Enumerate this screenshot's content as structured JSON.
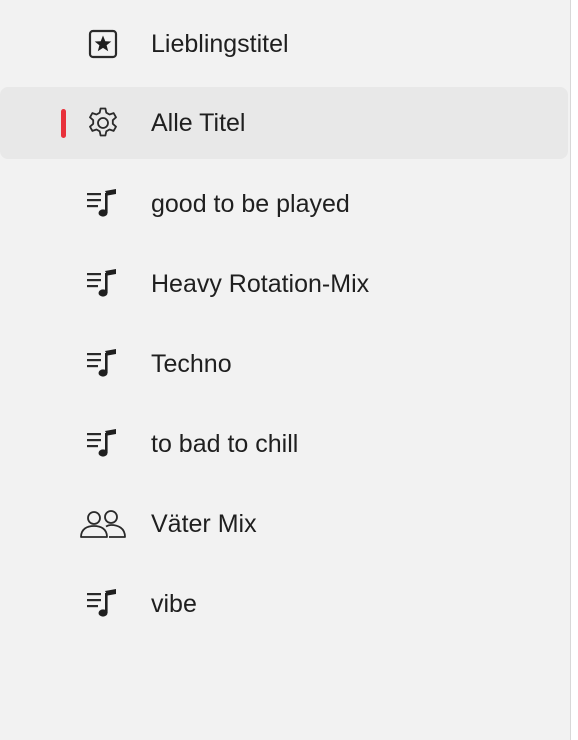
{
  "sidebar": {
    "selected_indicator_color": "#e8313b",
    "items": [
      {
        "label": "Lieblingstitel",
        "icon": "star-box-icon"
      },
      {
        "label": "Alle Titel",
        "icon": "gear-icon",
        "selected": true
      },
      {
        "label": "good to be played",
        "icon": "playlist-icon"
      },
      {
        "label": "Heavy Rotation-Mix",
        "icon": "playlist-icon"
      },
      {
        "label": "Techno",
        "icon": "playlist-icon"
      },
      {
        "label": "to bad to chill",
        "icon": "playlist-icon"
      },
      {
        "label": "Väter Mix",
        "icon": "people-icon"
      },
      {
        "label": "vibe",
        "icon": "playlist-icon"
      }
    ]
  }
}
